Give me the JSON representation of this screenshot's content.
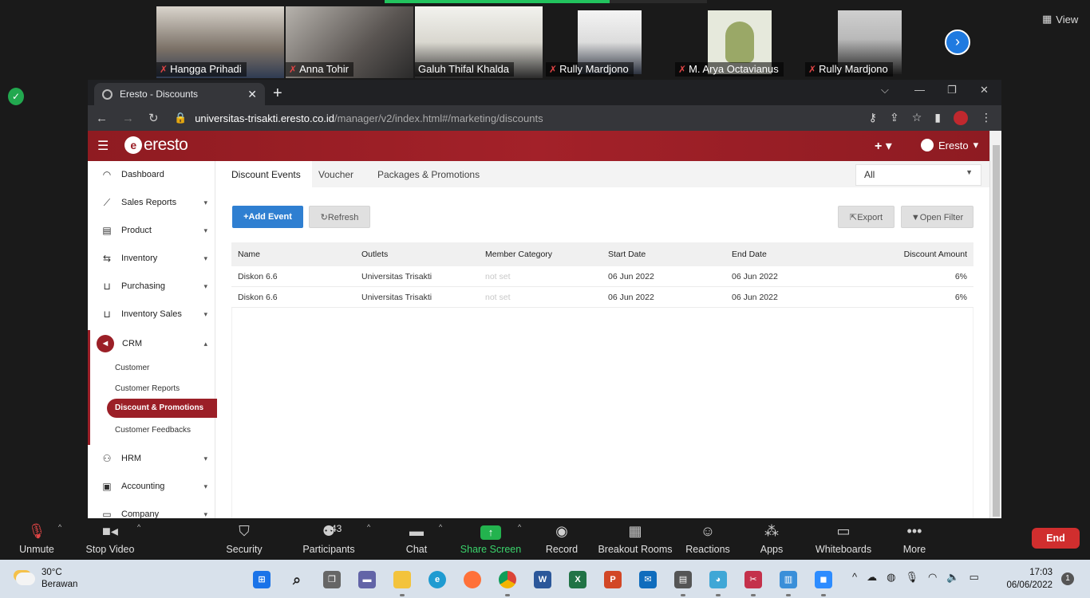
{
  "meeting": {
    "participants": [
      {
        "name": "Hangga Prihadi",
        "muted": true,
        "color": "#7a7066"
      },
      {
        "name": "Anna Tohir",
        "muted": true,
        "color": "#5a5552"
      },
      {
        "name": "Galuh Thifal Khalda",
        "muted": false,
        "color": "#d9d7cf"
      },
      {
        "name": "Rully Mardjono",
        "muted": true,
        "color": "#dcdcdc"
      },
      {
        "name": "M. Arya Octavianus",
        "muted": true,
        "color": "#e6e9dc"
      },
      {
        "name": "Rully Mardjono",
        "muted": true,
        "color": "#b9b9b9"
      }
    ],
    "view_label": "View",
    "controls": {
      "unmute": "Unmute",
      "stop_video": "Stop Video",
      "security": "Security",
      "participants": "Participants",
      "participants_count": "43",
      "chat": "Chat",
      "share_screen": "Share Screen",
      "record": "Record",
      "breakout_rooms": "Breakout Rooms",
      "reactions": "Reactions",
      "apps": "Apps",
      "whiteboards": "Whiteboards",
      "more": "More",
      "end": "End"
    }
  },
  "browser": {
    "tab_title": "Eresto - Discounts",
    "url_host": "universitas-trisakti.eresto.co.id",
    "url_path": "/manager/v2/index.html#/marketing/discounts"
  },
  "app": {
    "logo_text": "eresto",
    "user_name": "Eresto",
    "sidebar": [
      {
        "label": "Dashboard",
        "icon": "gauge-icon",
        "expandable": false
      },
      {
        "label": "Sales Reports",
        "icon": "chart-line-icon",
        "expandable": true
      },
      {
        "label": "Product",
        "icon": "food-cart-icon",
        "expandable": true
      },
      {
        "label": "Inventory",
        "icon": "arrows-exchange-icon",
        "expandable": true
      },
      {
        "label": "Purchasing",
        "icon": "shopping-cart-icon",
        "expandable": true
      },
      {
        "label": "Inventory Sales",
        "icon": "shopping-cart-icon",
        "expandable": true
      },
      {
        "label": "CRM",
        "icon": "megaphone-icon",
        "expandable": true
      },
      {
        "label": "HRM",
        "icon": "people-icon",
        "expandable": true
      },
      {
        "label": "Accounting",
        "icon": "wallet-icon",
        "expandable": true
      },
      {
        "label": "Company",
        "icon": "briefcase-icon",
        "expandable": true
      }
    ],
    "crm_submenu": [
      "Customer",
      "Customer Reports",
      "Discount & Promotions",
      "Customer Feedbacks"
    ],
    "tabs": [
      "Discount Events",
      "Voucher",
      "Packages & Promotions"
    ],
    "outlet_filter": "All",
    "buttons": {
      "add_event": "+Add Event",
      "refresh": "Refresh",
      "export": "Export",
      "open_filter": "Open Filter"
    },
    "table": {
      "columns": [
        "Name",
        "Outlets",
        "Member Category",
        "Start Date",
        "End Date",
        "Discount Amount"
      ],
      "rows": [
        [
          "Diskon 6.6",
          "Universitas Trisakti",
          "not set",
          "06 Jun 2022",
          "06 Jun 2022",
          "6%"
        ],
        [
          "Diskon 6.6",
          "Universitas Trisakti",
          "not set",
          "06 Jun 2022",
          "06 Jun 2022",
          "6%"
        ]
      ]
    }
  },
  "taskbar": {
    "temperature": "30°C",
    "weather": "Berawan",
    "time": "17:03",
    "date": "06/06/2022",
    "notification_count": "1"
  }
}
